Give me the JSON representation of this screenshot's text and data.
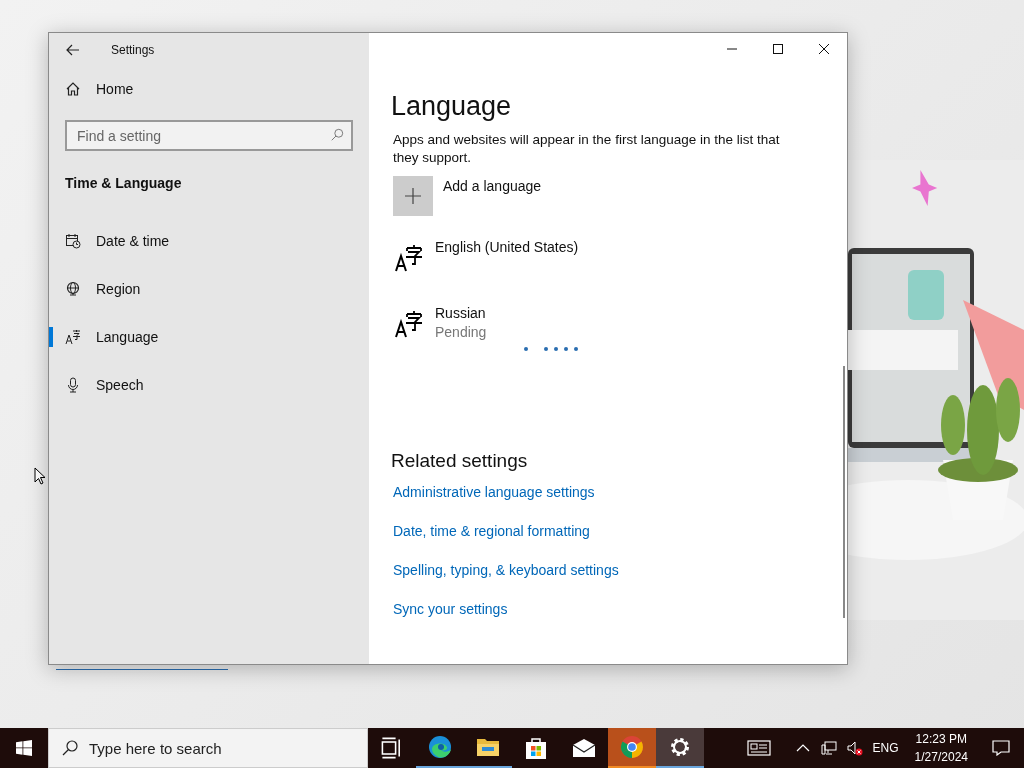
{
  "window": {
    "title": "Settings"
  },
  "sidebar": {
    "home": "Home",
    "search": {
      "placeholder": "Find a setting"
    },
    "section": "Time & Language",
    "items": [
      {
        "label": "Date & time",
        "kind": "calendar",
        "selected": false
      },
      {
        "label": "Region",
        "kind": "globe",
        "selected": false
      },
      {
        "label": "Language",
        "kind": "language",
        "selected": true
      },
      {
        "label": "Speech",
        "kind": "microphone",
        "selected": false
      }
    ]
  },
  "content": {
    "title": "Language",
    "description": "Apps and websites will appear in the first language in the list that they support.",
    "add_button": "Add a language",
    "languages": [
      {
        "name": "English (United States)"
      },
      {
        "name": "Russian",
        "status": "Pending"
      }
    ],
    "related_title": "Related settings",
    "links": [
      "Administrative language settings",
      "Date, time & regional formatting",
      "Spelling, typing, & keyboard settings",
      "Sync your settings"
    ]
  },
  "taskbar": {
    "search": {
      "placeholder": "Type here to search"
    },
    "apps": [
      {
        "kind": "taskview",
        "running": false,
        "selected": false,
        "flashing": false
      },
      {
        "kind": "edge",
        "running": true,
        "selected": false,
        "flashing": false
      },
      {
        "kind": "explorer",
        "running": true,
        "selected": false,
        "flashing": false
      },
      {
        "kind": "store",
        "running": false,
        "selected": false,
        "flashing": false
      },
      {
        "kind": "mail",
        "running": false,
        "selected": false,
        "flashing": false
      },
      {
        "kind": "chrome",
        "running": true,
        "selected": false,
        "flashing": true
      },
      {
        "kind": "settings",
        "running": true,
        "selected": true,
        "flashing": false
      }
    ],
    "input_language": "ENG",
    "time": "12:23 PM",
    "date": "1/27/2024"
  }
}
